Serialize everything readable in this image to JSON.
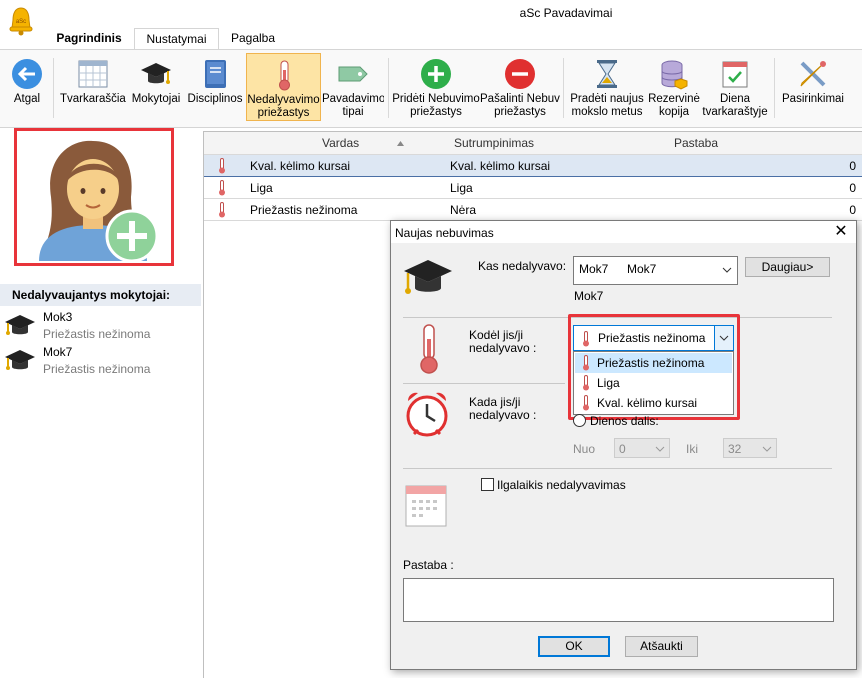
{
  "app": {
    "title": "aSc Pavadavimai"
  },
  "tabs": [
    {
      "label": "Pagrindinis"
    },
    {
      "label": "Nustatymai"
    },
    {
      "label": "Pagalba"
    }
  ],
  "ribbon": {
    "back": "Atgal",
    "timetables": "Tvarkaraščiai",
    "teachers": "Mokytojai",
    "subjects": "Disciplinos",
    "absence_reasons_1": "Nedalyvavimo",
    "absence_reasons_2": "priežastys",
    "substitution_types_1": "Pavadavimo",
    "substitution_types_2": "tipai",
    "add_reason_1": "Pridėti Nebuvimo",
    "add_reason_2": "priežastys",
    "remove_reason_1": "Pašalinti Nebuvimo",
    "remove_reason_2": "priežastys",
    "new_year_1": "Pradėti naujus",
    "new_year_2": "mokslo metus",
    "backup_1": "Rezervinė",
    "backup_2": "kopija",
    "day_tt_1": "Diena",
    "day_tt_2": "tvarkaraštyje",
    "options": "Pasirinkimai"
  },
  "left_panel": {
    "header": "Nedalyvaujantys mokytojai:",
    "items": [
      {
        "name": "Mok3",
        "reason": "Priežastis nežinoma"
      },
      {
        "name": "Mok7",
        "reason": "Priežastis nežinoma"
      }
    ]
  },
  "grid": {
    "columns": {
      "name": "Vardas",
      "short": "Sutrumpinimas",
      "note": "Pastaba"
    },
    "rows": [
      {
        "name": "Kval. kėlimo kursai",
        "short": "Kval. kėlimo kursai",
        "value": "0"
      },
      {
        "name": "Liga",
        "short": "Liga",
        "value": "0"
      },
      {
        "name": "Priežastis nežinoma",
        "short": "Nėra",
        "value": "0"
      }
    ]
  },
  "dialog": {
    "title": "Naujas nebuvimas",
    "who_label": "Kas nedalyvavo:",
    "who_value_1": "Mok7",
    "who_value_2": "Mok7",
    "who_sub": "Mok7",
    "more_button": "Daugiau>",
    "why_label_1": "Kodėl jis/ji",
    "why_label_2": "nedalyvavo :",
    "why_value": "Priežastis nežinoma",
    "why_options": [
      "Priežastis nežinoma",
      "Liga",
      "Kval. kėlimo kursai"
    ],
    "when_label_1": "Kada jis/ji",
    "when_label_2": "nedalyvavo :",
    "day_part_label": "Dienos dalis:",
    "from_label": "Nuo",
    "from_value": "0",
    "to_label": "Iki",
    "to_value": "32",
    "long_term_label": "Ilgalaikis nedalyvavimas",
    "note_label": "Pastaba :",
    "ok": "OK",
    "cancel": "Atšaukti"
  }
}
